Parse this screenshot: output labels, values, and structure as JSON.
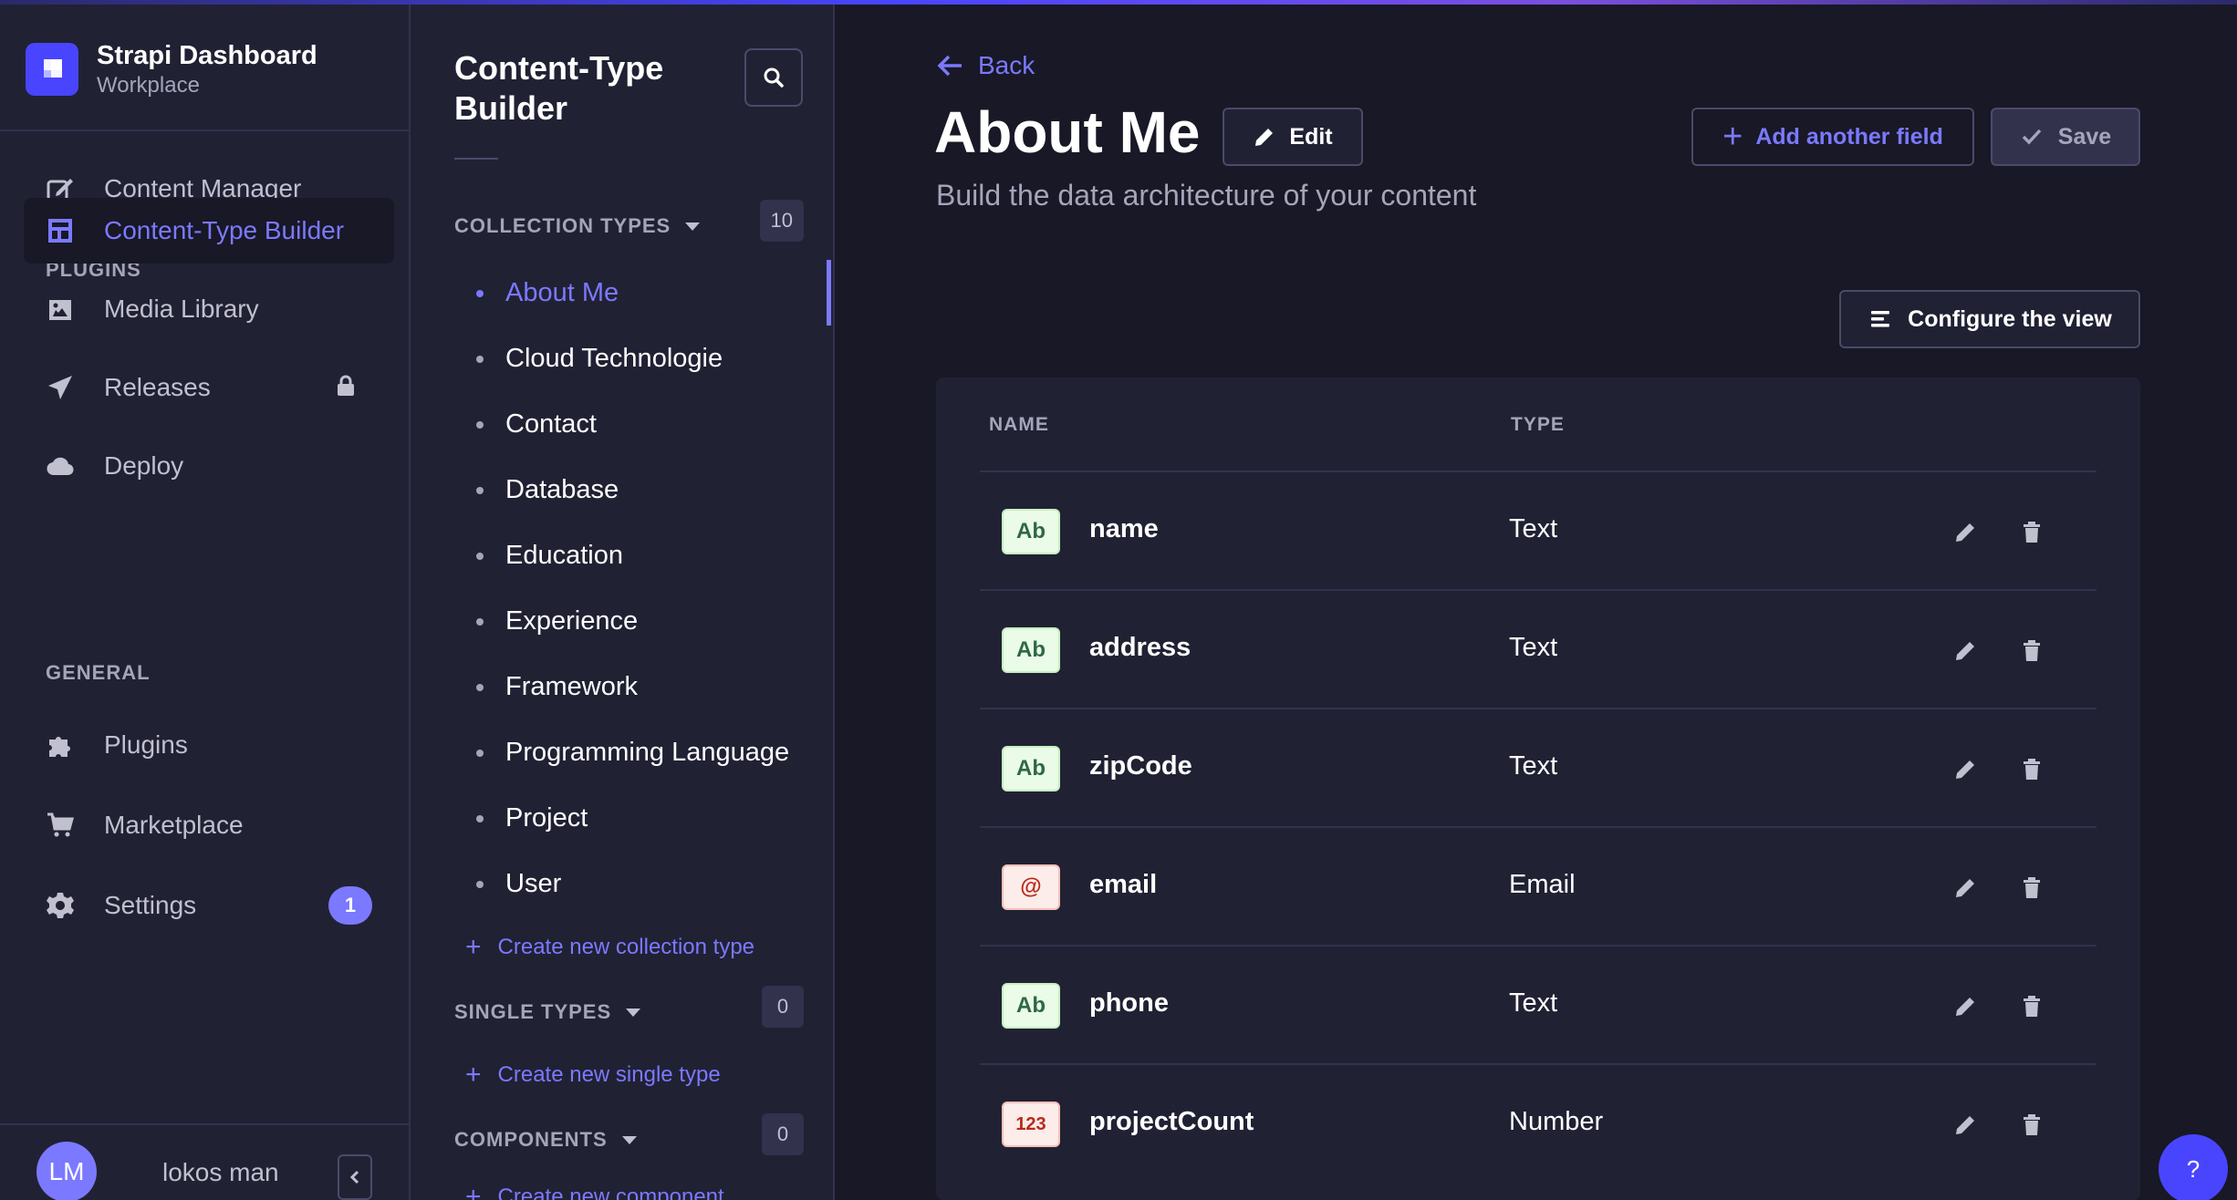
{
  "brand": {
    "title": "Strapi Dashboard",
    "subtitle": "Workplace"
  },
  "nav": {
    "content_manager": "Content Manager",
    "plugins_heading": "PLUGINS",
    "ctb": "Content-Type Builder",
    "media": "Media Library",
    "releases": "Releases",
    "deploy": "Deploy",
    "general_heading": "GENERAL",
    "plugins": "Plugins",
    "marketplace": "Marketplace",
    "settings": "Settings",
    "settings_badge": "1"
  },
  "user": {
    "initials": "LM",
    "name": "lokos man"
  },
  "subnav": {
    "title": "Content-Type Builder",
    "collection_heading": "COLLECTION TYPES",
    "collection_count": "10",
    "collection_items": [
      "About Me",
      "Cloud Technologie",
      "Contact",
      "Database",
      "Education",
      "Experience",
      "Framework",
      "Programming Language",
      "Project",
      "User"
    ],
    "create_collection": "Create new collection type",
    "single_heading": "SINGLE TYPES",
    "single_count": "0",
    "create_single": "Create new single type",
    "components_heading": "COMPONENTS",
    "components_count": "0",
    "create_component": "Create new component"
  },
  "main": {
    "back": "Back",
    "title": "About Me",
    "edit": "Edit",
    "subtitle": "Build the data architecture of your content",
    "add_field": "Add another field",
    "save": "Save",
    "configure": "Configure the view",
    "col_name": "NAME",
    "col_type": "TYPE",
    "fields": [
      {
        "badge": "Ab",
        "name": "name",
        "type": "Text",
        "kind": "text"
      },
      {
        "badge": "Ab",
        "name": "address",
        "type": "Text",
        "kind": "text"
      },
      {
        "badge": "Ab",
        "name": "zipCode",
        "type": "Text",
        "kind": "text"
      },
      {
        "badge": "@",
        "name": "email",
        "type": "Email",
        "kind": "email"
      },
      {
        "badge": "Ab",
        "name": "phone",
        "type": "Text",
        "kind": "text"
      },
      {
        "badge": "123",
        "name": "projectCount",
        "type": "Number",
        "kind": "number"
      }
    ]
  },
  "help": "?",
  "colors": {
    "accent": "#7b79ff",
    "primary": "#4945ff",
    "bg": "#181826",
    "panel": "#212134"
  }
}
